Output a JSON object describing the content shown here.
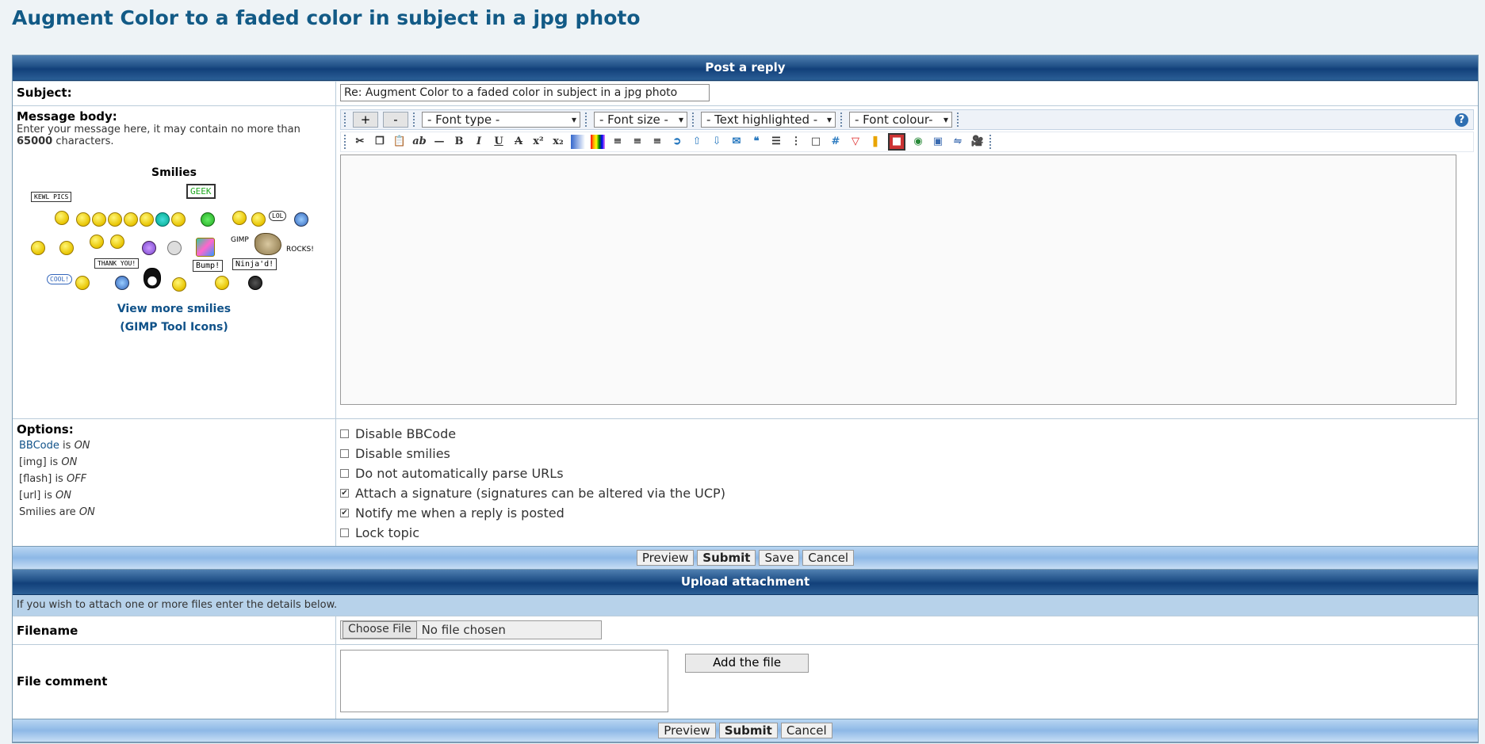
{
  "page": {
    "title": "Augment Color to a faded color in subject in a jpg photo"
  },
  "post": {
    "header": "Post a reply",
    "subject_label": "Subject:",
    "subject_value": "Re: Augment Color to a faded color in subject in a jpg photo",
    "body_label": "Message body:",
    "body_hint_pre": "Enter your message here, it may contain no more than",
    "body_limit": "65000",
    "body_hint_post": "characters.",
    "smilies_title": "Smilies",
    "smilies_signs": [
      "KEWL PICS",
      "GEEK",
      "LOL",
      "GIMP",
      "ROCKS!",
      "COOL!",
      "THANK YOU!",
      "Bump!",
      "Ninja'd!"
    ],
    "view_more": "View more smilies",
    "gimp_icons": "(GIMP Tool Icons)"
  },
  "toolbar": {
    "plus": "+",
    "minus": "-",
    "font_type": "- Font type -",
    "font_size": "- Font size -",
    "text_highlight": "- Text highlighted -",
    "font_colour": "- Font colour-",
    "help": "?"
  },
  "options": {
    "label": "Options:",
    "bbcode_link": "BBCode",
    "bbcode_is": "is",
    "bbcode_state": "ON",
    "img": "[img] is",
    "img_state": "ON",
    "flash": "[flash] is",
    "flash_state": "OFF",
    "url": "[url] is",
    "url_state": "ON",
    "smilies": "Smilies are",
    "smilies_state": "ON",
    "checkboxes": [
      {
        "label": "Disable BBCode",
        "checked": false
      },
      {
        "label": "Disable smilies",
        "checked": false
      },
      {
        "label": "Do not automatically parse URLs",
        "checked": false
      },
      {
        "label": "Attach a signature (signatures can be altered via the UCP)",
        "checked": true
      },
      {
        "label": "Notify me when a reply is posted",
        "checked": true
      },
      {
        "label": "Lock topic",
        "checked": false
      }
    ]
  },
  "buttons": {
    "preview": "Preview",
    "submit": "Submit",
    "save": "Save",
    "cancel": "Cancel"
  },
  "upload": {
    "header": "Upload attachment",
    "info": "If you wish to attach one or more files enter the details below.",
    "filename_label": "Filename",
    "choose_file": "Choose File",
    "no_file": "No file chosen",
    "comment_label": "File comment",
    "add_file": "Add the file"
  }
}
